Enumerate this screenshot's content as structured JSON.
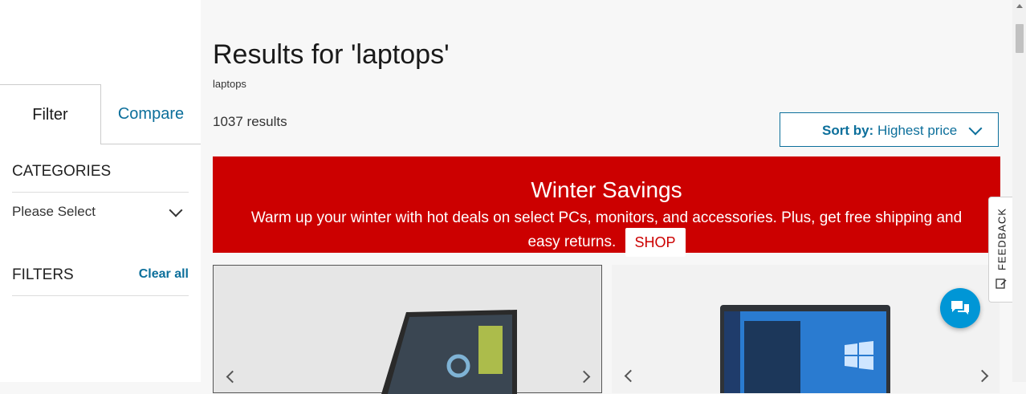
{
  "sidebar": {
    "tabs": [
      {
        "label": "Filter"
      },
      {
        "label": "Compare"
      }
    ],
    "categories_title": "CATEGORIES",
    "categories_select": "Please Select",
    "filters_title": "FILTERS",
    "clear_all": "Clear all"
  },
  "main": {
    "title": "Results for 'laptops'",
    "query": "laptops",
    "results_count": "1037 results",
    "sort": {
      "prefix": "Sort by:",
      "value": "Highest price"
    },
    "banner": {
      "title": "Winter Savings",
      "text": "Warm up your winter with hot deals on select PCs, monitors, and accessories. Plus, get free shipping and easy returns.",
      "button": "SHOP"
    }
  },
  "feedback": {
    "label": "FEEDBACK"
  },
  "icons": {
    "chat": "chat-bubbles-icon",
    "feedback": "edit-note-icon"
  },
  "colors": {
    "accent": "#0c6f9b",
    "banner": "#cc0000",
    "chat": "#0096d6"
  }
}
